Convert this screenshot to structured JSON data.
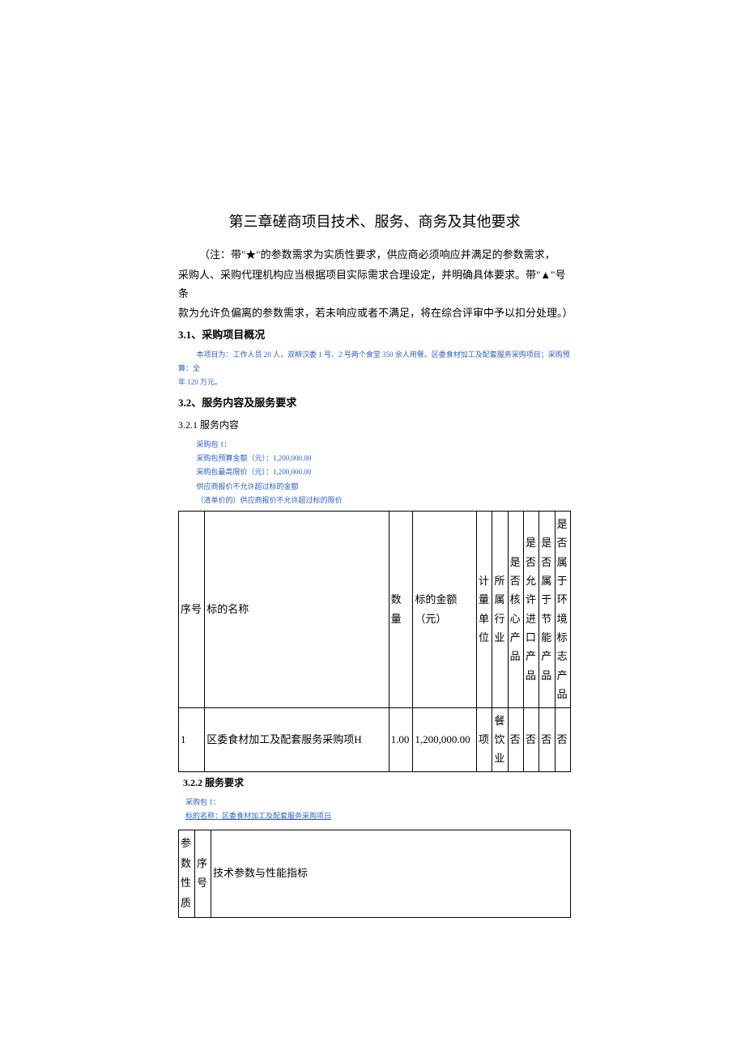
{
  "chapter_title": "第三章磋商项目技术、服务、商务及其他要求",
  "note_line1": "（注：带\"★\"的参数需求为实质性要求，供应商必须响应并满足的参数需求，",
  "note_line2": "采购人、采购代理机构应当根据项目实际需求合理设定，并明确具体要求。带\"▲\"号条",
  "note_line3": "款为允许负偏离的参数需求，若未响应或者不满足，将在综合评审中予以扣分处理。）",
  "sec31_label": "3.1、采购项目概况",
  "blue1a": "本项目为：工作人员 20 人，双柳汉委 1 号、2 号两个食堂 350 余人用餐。区委食材加工及配套服务采购项目；采购预算：全",
  "blue1b": "年 120 万元。",
  "sec32_label": "3.2、服务内容及服务要求",
  "sec321_label": "3.2.1 服务内容",
  "blue2a": "采购包 1：",
  "blue2b": "采购包预算金额（元）：1,200,000.00",
  "blue2c": "采购包最高限价（元）：1,200,000.00",
  "blue2d": "供应商报价不允许超过标的金额",
  "blue2e": "（清单价的）供应商报价不允许超过标的限价",
  "table1": {
    "h_seq": "序号",
    "h_name": "标的名称",
    "h_qty": "数量",
    "h_amount": "标的金额（元）",
    "h_unit": "计量单位",
    "h_industry": "所属行业",
    "h_core": "是否核心产品",
    "h_import": "是否允许进口产品",
    "h_energy": "是否属于节能产品",
    "h_env": "是否属于环境标志产品",
    "row1": {
      "seq": "1",
      "name": "区委食材加工及配套服务采购项H",
      "qty": "1.00",
      "amount": "1,200,000.00",
      "unit": "项",
      "industry": "餐饮业",
      "core": "否",
      "import": "否",
      "energy": "否",
      "env": "否"
    }
  },
  "sec322_label": "3.2.2 服务要求",
  "blue3a": "采购包 1：",
  "blue3b": "标的名称：区委食材加工及配套服务采购项日",
  "table2": {
    "h_param": "参数性质",
    "h_seq": "序号",
    "h_spec": "技术参数与性能指标"
  }
}
